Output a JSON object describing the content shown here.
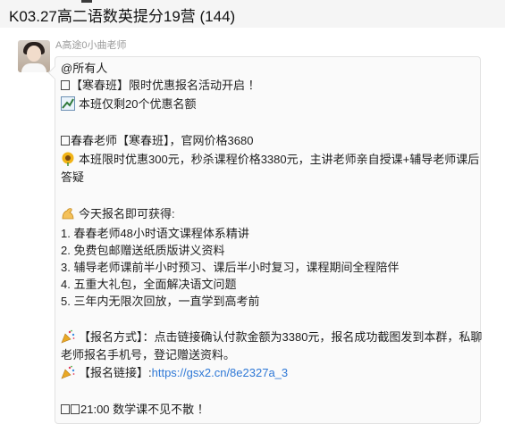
{
  "window": {
    "title": "K03.27高二语数英提分19营 (144)"
  },
  "message": {
    "sender": "A高途0小曲老师",
    "lines": {
      "l1": "@所有人",
      "l2": "【寒春班】限时优惠报名活动开启 ！",
      "l3": "本班仅剩20个优惠名额",
      "l4": "春春老师【寒春班】，官网价格3680",
      "l5": "本班限时优惠300元，秒杀课程价格3380元，主讲老师亲自授课+辅导老师课后",
      "l6": "答疑",
      "l7": "今天报名即可获得:",
      "l8": "1. 春春老师48小时语文课程体系精讲",
      "l9": "2. 免费包邮赠送纸质版讲义资料",
      "l10": "3. 辅导老师课前半小时预习、课后半小时复习，课程期间全程陪伴",
      "l11": "4. 五重大礼包，全面解决语文问题",
      "l12": "5. 三年内无限次回放，一直学到高考前",
      "l13": "【报名方式】：点击链接确认付款金额为3380元，报名成功截图发到本群，私聊",
      "l14": "老师报名手机号，登记赠送资料。",
      "l15_label": "【报名链接】:",
      "l15_link": "https://gsx2.cn/8e2327a_3",
      "l16": "21:00 数学课不见不散 ！"
    }
  }
}
